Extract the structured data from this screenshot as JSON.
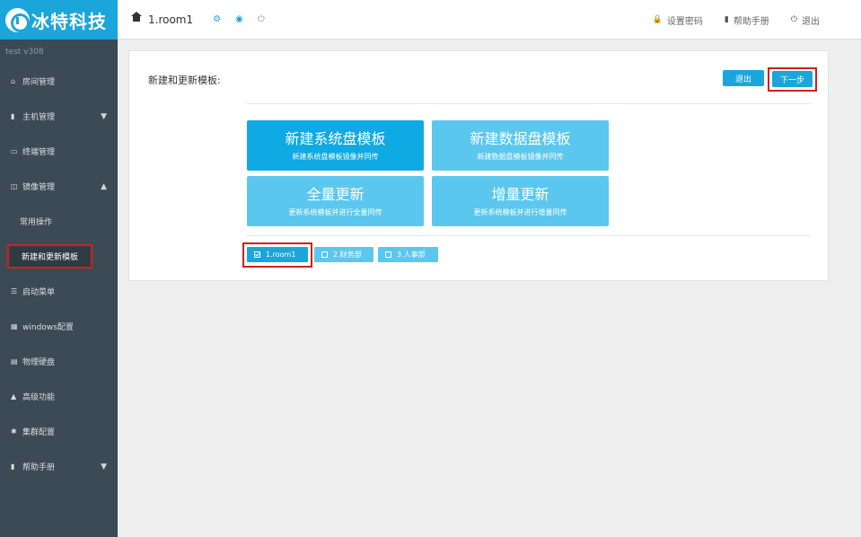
{
  "brand": {
    "name": "冰特科技",
    "color": "#1aa6db"
  },
  "header": {
    "room": "1.room1",
    "icons": [
      "gear-icon",
      "globe-icon",
      "power-icon"
    ],
    "links": [
      {
        "label": "设置密码",
        "icon": "lock-icon"
      },
      {
        "label": "帮助手册",
        "icon": "book-icon"
      },
      {
        "label": "退出",
        "icon": "power-icon"
      }
    ]
  },
  "sidebar": {
    "version": "test  v308",
    "items": [
      {
        "label": "房间管理",
        "icon": "home-icon"
      },
      {
        "label": "主机管理",
        "icon": "server-icon",
        "caret": "down"
      },
      {
        "label": "终端管理",
        "icon": "monitor-icon"
      },
      {
        "label": "镜像管理",
        "icon": "database-icon",
        "caret": "up"
      },
      {
        "label": "常用操作",
        "sub": true
      },
      {
        "label": "新建和更新模板",
        "sub": true,
        "active": true
      },
      {
        "label": "启动菜单",
        "icon": "list-icon"
      },
      {
        "label": "windows配置",
        "icon": "windows-icon"
      },
      {
        "label": "物理硬盘",
        "icon": "hdd-icon"
      },
      {
        "label": "高级功能",
        "icon": "warning-icon"
      },
      {
        "label": "集群配置",
        "icon": "gear-icon"
      },
      {
        "label": "帮助手册",
        "icon": "book-icon",
        "caret": "down"
      }
    ]
  },
  "main": {
    "title": "新建和更新模板:",
    "exit_label": "退出",
    "next_label": "下一步",
    "tiles": [
      {
        "title": "新建系统盘模板",
        "desc": "新建系统盘模板镜像并同传"
      },
      {
        "title": "新建数据盘模板",
        "desc": "新建数据盘模板镜像并同传"
      },
      {
        "title": "全量更新",
        "desc": "更新系统模板并进行全量同传"
      },
      {
        "title": "增量更新",
        "desc": "更新系统模板并进行增量同传"
      }
    ],
    "tabs": [
      {
        "label": "1.room1",
        "checked": true
      },
      {
        "label": "2.财务部",
        "checked": false
      },
      {
        "label": "3.人事部",
        "checked": false
      }
    ]
  }
}
